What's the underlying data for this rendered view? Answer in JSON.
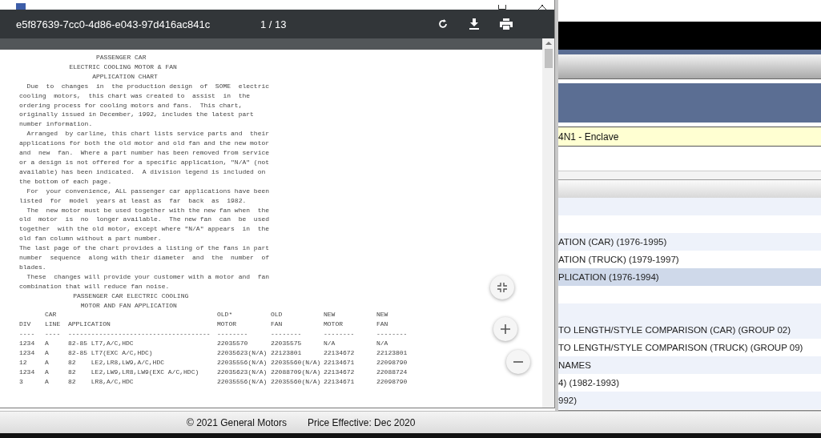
{
  "viewer": {
    "file_name": "e5f87639-7cc0-4d86-e043-97d416ac841c",
    "page_indicator": "1 / 13",
    "document": {
      "lines": [
        "                    PASSENGER CAR",
        "             ELECTRIC COOLING MOTOR & FAN",
        "                   APPLICATION CHART",
        "  Due  to  changes  in  the production design  of  SOME  electric",
        "cooling  motors,  this chart was created to  assist  in  the",
        "ordering process for cooling motors and fans.  This chart,",
        "originally issued in December, 1992, includes the latest part",
        "number information.",
        "  Arranged  by carline, this chart lists service parts and  their",
        "applications for both the old motor and old fan and the new motor",
        "and  new  fan.  Where a part number has been removed from service",
        "or a design is not offered for a specific application, \"N/A\" (not",
        "available) has been indicated.  A division legend is included on",
        "the bottom of each page.",
        "  For  your convenience, ALL passenger car applications have been",
        "listed  for  model  years at least as  far  back  as  1982.",
        "  The  new motor must be used together with the new fan when  the",
        "old  motor  is  no  longer available.  The new fan  can  be  used",
        "together  with the old motor, except where \"N/A\" appears  in  the",
        "old fan column without a part number.",
        "The last page of the chart provides a listing of the fans in part",
        "number  sequence  along with their diameter  and  the  number  of",
        "blades.",
        "  These  changes will provide your customer with a motor and  fan",
        "combination that will reduce fan noise.",
        "              PASSENGER CAR ELECTRIC COOLING",
        "                MOTOR AND FAN APPLICATION"
      ],
      "table": {
        "columns": [
          {
            "heading": [
              "DIV"
            ],
            "rule": "----"
          },
          {
            "heading": [
              "CAR",
              "LINE"
            ],
            "rule": "----"
          },
          {
            "heading": [
              "APPLICATION"
            ],
            "rule": "-------------------------------------"
          },
          {
            "heading": [
              "OLD*",
              "MOTOR"
            ],
            "rule": "--------"
          },
          {
            "heading": [
              "OLD",
              "FAN"
            ],
            "rule": "--------"
          },
          {
            "heading": [
              "NEW",
              "MOTOR"
            ],
            "rule": "--------"
          },
          {
            "heading": [
              "NEW",
              "FAN"
            ],
            "rule": "--------"
          }
        ],
        "rows": [
          [
            "1234",
            "A",
            "82-85 LT7,A/C,HDC",
            "22035570",
            "22035575",
            "N/A",
            "N/A"
          ],
          [
            "1234",
            "A",
            "82-85 LT7(EXC A/C,HDC)",
            "22035623(N/A)",
            "22123801",
            "22134672",
            "22123801"
          ],
          [
            "12",
            "A",
            "82    LE2,LR8,LW9,A/C,HDC",
            "22035556(N/A)",
            "22035560(N/A)",
            "22134671",
            "22098790"
          ],
          [
            "1234",
            "A",
            "82    LE2,LW9,LR8,LW9(EXC A/C,HDC)",
            "22035623(N/A)",
            "22088709(N/A)",
            "22134672",
            "22088724"
          ],
          [
            "3",
            "A",
            "82    LR8,A/C,HDC",
            "22035556(N/A)",
            "22035560(N/A)",
            "22134671",
            "22098790"
          ]
        ]
      }
    }
  },
  "catalog": {
    "vehicle": "4N1 - Enclave",
    "items": [
      {
        "label": "ATION (CAR) (1976-1995)",
        "selected": false
      },
      {
        "label": "ATION (TRUCK) (1979-1997)",
        "selected": false
      },
      {
        "label": "PLICATION (1976-1994)",
        "selected": true
      },
      {
        "label": "TO LENGTH/STYLE COMPARISON (CAR) (GROUP 02)",
        "selected": false
      },
      {
        "label": "TO LENGTH/STYLE COMPARISON (TRUCK) (GROUP 09)",
        "selected": false
      },
      {
        "label": "NAMES",
        "selected": false
      },
      {
        "label": "4) (1982-1993)",
        "selected": false
      },
      {
        "label": "992)",
        "selected": false
      }
    ]
  },
  "footer": {
    "copyright": "© 2021 General Motors",
    "price_effective": "Price Effective: Dec 2020"
  }
}
